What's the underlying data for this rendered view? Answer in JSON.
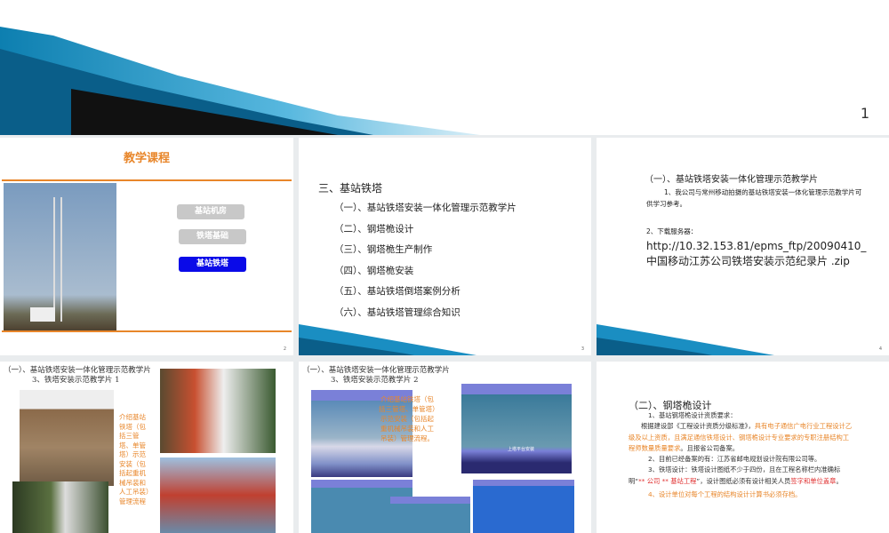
{
  "page_number": "1",
  "slides": [
    {
      "number": "2",
      "title": "教学课程",
      "buttons": [
        "基站机房",
        "铁塔基础",
        "基站铁塔"
      ]
    },
    {
      "number": "3",
      "heading": "三、基站铁塔",
      "items": [
        "（一）、基站铁塔安装一体化管理示范教学片",
        "（二）、钢塔桅设计",
        "（三）、钢塔桅生产制作",
        "（四）、钢塔桅安装",
        "（五）、基站铁塔倒塔案例分析",
        "（六）、基站铁塔管理综合知识"
      ]
    },
    {
      "number": "4",
      "heading": "（一）、基站铁塔安装一体化管理示范教学片",
      "p1": "1、我公司与常州移动拍摄的基站铁塔安装一体化管理示范教学片可供学习参考。",
      "p2_label": "2、下载服务器：",
      "p2_link": "http://10.32.153.81/epms_ftp/20090410_ 中国移动江苏公司铁塔安装示范纪录片 .zip"
    },
    {
      "heading": "（一）、基站铁塔安装一体化管理示范教学片",
      "sub": "3、铁塔安装示范教学片 1",
      "caption": "介绍基站铁塔（包括三管塔、单管塔）示范安装（包括起重机械吊装和人工吊装）管理流程"
    },
    {
      "heading": "（一）、基站铁塔安装一体化管理示范教学片",
      "sub": "3、铁塔安装示范教学片 2",
      "caption": "介绍基站铁塔（包括三管塔、单管塔）示范安装（包括起重机械吊装和人工吊装）管理流程。",
      "video_caption": "上塔平台安装"
    },
    {
      "heading": "（二）、钢塔桅设计",
      "l1": "1、基站钢塔桅设计资质要求：",
      "l2a": "根据建设部《工程设计资质分级标准》，",
      "l2b": "具有电子通信广电行业工程设计乙级及以上资质，且满足通信铁塔设计、钢塔桅设计专业要求的专职注册结构工程师数量质量要求",
      "l2c": "。且报省公司备案。",
      "l3": "2、目前已经备案的有：江苏省邮电规划设计院有限公司等。",
      "l4a": "3、铁塔设计：铁塔设计图纸不少于四份，且在工程名称栏内准确标明“",
      "l4b": "** 公司 ** 基站工程",
      "l4c": "”，设计图纸必须有设计相关人员",
      "l4d": "签字和单位盖章",
      "l4e": "。",
      "l5": "4、设计单位对每个工程的结构设计计算书必须存档。"
    }
  ],
  "colors": {
    "orange": "#e8862a",
    "blue_button": "#0a0ae8",
    "gray_button": "#c8c8c8",
    "accent_blue": "#1a8ec2"
  }
}
